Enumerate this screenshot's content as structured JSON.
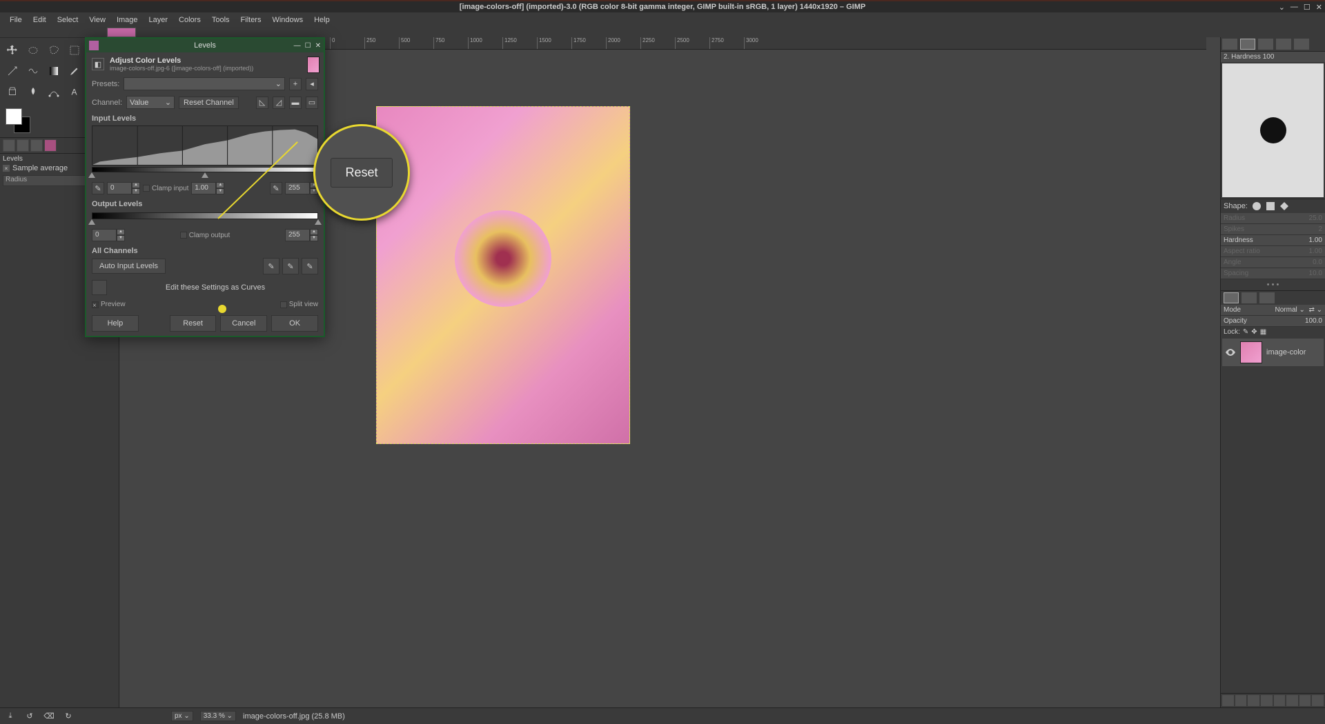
{
  "title": "[image-colors-off] (imported)-3.0 (RGB color 8-bit gamma integer, GIMP built-in sRGB, 1 layer) 1440x1920 – GIMP",
  "menu": [
    "File",
    "Edit",
    "Select",
    "View",
    "Image",
    "Layer",
    "Colors",
    "Tools",
    "Filters",
    "Windows",
    "Help"
  ],
  "left": {
    "levels_title": "Levels",
    "sample_avg_label": "Sample average",
    "radius_label": "Radius"
  },
  "dialog": {
    "window_title": "Levels",
    "header_title": "Adjust Color Levels",
    "header_sub": "image-colors-off.jpg-6 ([image-colors-off] (imported))",
    "presets_label": "Presets:",
    "channel_label": "Channel:",
    "channel_value": "Value",
    "reset_channel": "Reset Channel",
    "input_levels": "Input Levels",
    "low_val": "0",
    "gamma_val": "1.00",
    "high_val": "255",
    "clamp_input": "Clamp input",
    "output_levels": "Output Levels",
    "out_low": "0",
    "out_high": "255",
    "clamp_output": "Clamp output",
    "all_channels": "All Channels",
    "auto_input": "Auto Input Levels",
    "edit_as_curves": "Edit these Settings as Curves",
    "preview": "Preview",
    "split_view": "Split view",
    "help": "Help",
    "reset": "Reset",
    "cancel": "Cancel",
    "ok": "OK"
  },
  "magnifier": {
    "label": "Reset"
  },
  "right": {
    "brush_name": "2. Hardness 100",
    "shape_label": "Shape:",
    "radius_label": "Radius",
    "radius_val": "25.0",
    "spikes_label": "Spikes",
    "spikes_val": "2",
    "hardness_label": "Hardness",
    "hardness_val": "1.00",
    "aspect_label": "Aspect ratio",
    "aspect_val": "1.00",
    "angle_label": "Angle",
    "angle_val": "0.0",
    "spacing_label": "Spacing",
    "spacing_val": "10.0",
    "mode_label": "Mode",
    "mode_val": "Normal",
    "opacity_label": "Opacity",
    "opacity_val": "100.0",
    "lock_label": "Lock:",
    "layer_name": "image-color"
  },
  "status": {
    "unit": "px",
    "zoom": "33.3 %",
    "file_info": "image-colors-off.jpg (25.8 MB)"
  }
}
